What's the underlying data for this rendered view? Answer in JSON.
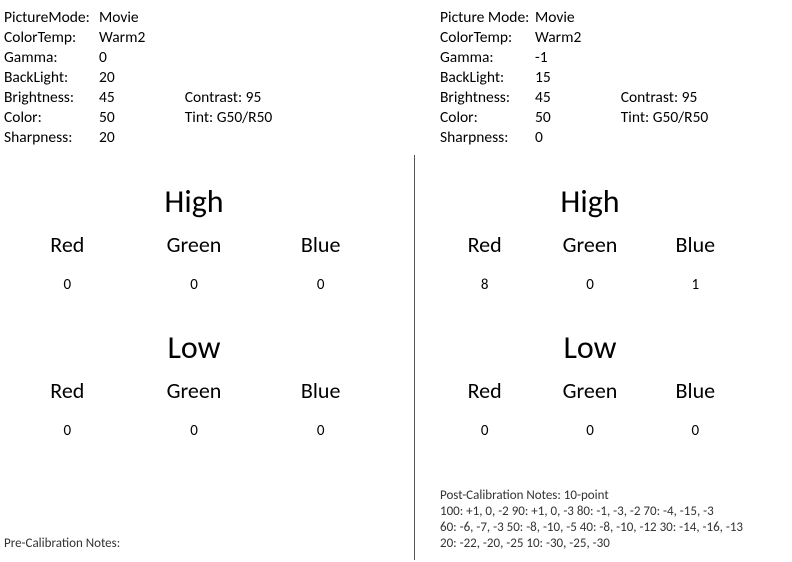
{
  "left": {
    "settings": {
      "pictureMode_label": "PictureMode:",
      "pictureMode_value": "Movie",
      "colorTemp_label": "ColorTemp:",
      "colorTemp_value": "Warm2",
      "gamma_label": "Gamma:",
      "gamma_value": "0",
      "backlight_label": "BackLight:",
      "backlight_value": "20",
      "brightness_label": "Brightness:",
      "brightness_value": "45",
      "contrast_label": "Contrast:",
      "contrast_value": "95",
      "color_label": "Color:",
      "color_value": "50",
      "tint_label": "Tint:",
      "tint_value": "G50/R50",
      "sharpness_label": "Sharpness:",
      "sharpness_value": "20"
    },
    "high": {
      "title": "High",
      "red_label": "Red",
      "green_label": "Green",
      "blue_label": "Blue",
      "red": "0",
      "green": "0",
      "blue": "0"
    },
    "low": {
      "title": "Low",
      "red_label": "Red",
      "green_label": "Green",
      "blue_label": "Blue",
      "red": "0",
      "green": "0",
      "blue": "0"
    },
    "notes_label": "Pre-Calibration Notes:"
  },
  "right": {
    "settings": {
      "pictureMode_label": "Picture Mode:",
      "pictureMode_value": "Movie",
      "colorTemp_label": "ColorTemp:",
      "colorTemp_value": "Warm2",
      "gamma_label": "Gamma:",
      "gamma_value": "-1",
      "backlight_label": "BackLight:",
      "backlight_value": "15",
      "brightness_label": "Brightness:",
      "brightness_value": "45",
      "contrast_label": "Contrast:",
      "contrast_value": "95",
      "color_label": "Color:",
      "color_value": "50",
      "tint_label": "Tint:",
      "tint_value": "G50/R50",
      "sharpness_label": "Sharpness:",
      "sharpness_value": "0"
    },
    "high": {
      "title": "High",
      "red_label": "Red",
      "green_label": "Green",
      "blue_label": "Blue",
      "red": "8",
      "green": "0",
      "blue": "1"
    },
    "low": {
      "title": "Low",
      "red_label": "Red",
      "green_label": "Green",
      "blue_label": "Blue",
      "red": "0",
      "green": "0",
      "blue": "0"
    },
    "notes_label": "Post-Calibration Notes: 10-point",
    "notes_line1": "100: +1, 0, -2 90: +1, 0, -3 80: -1, -3, -2 70: -4, -15, -3",
    "notes_line2": "60: -6, -7, -3 50: -8, -10, -5 40: -8, -10, -12 30: -14, -16, -13",
    "notes_line3": "20: -22, -20, -25 10: -30, -25, -30"
  }
}
